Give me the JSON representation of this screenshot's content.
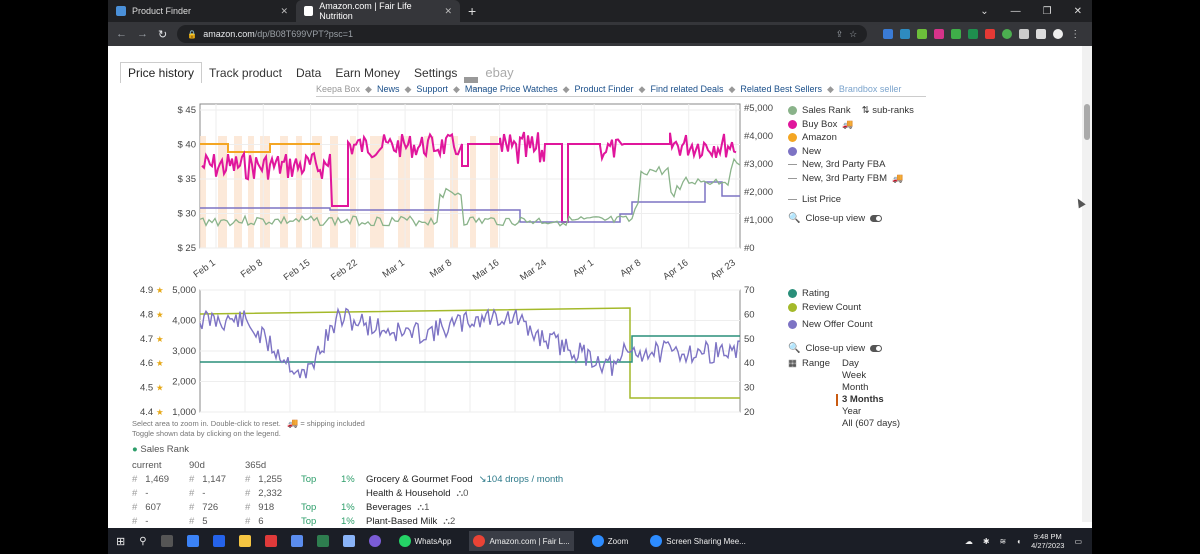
{
  "browser": {
    "tabs": [
      {
        "title": "Product Finder",
        "active": false
      },
      {
        "title": "Amazon.com | Fair Life Nutrition",
        "active": true
      }
    ],
    "new_tab": "+",
    "url_host": "amazon.com",
    "url_path": "/dp/B08T699VPT?psc=1"
  },
  "keepa": {
    "tabs": [
      "Price history",
      "Track product",
      "Data",
      "Earn Money",
      "Settings",
      "—",
      "ebay"
    ],
    "links": [
      "Keepa Box",
      "News",
      "Support",
      "Manage Price Watches",
      "Product Finder",
      "Find related Deals",
      "Related Best Sellers",
      "Brandbox seller"
    ]
  },
  "colors": {
    "sales_rank": "#8ab38a",
    "buy_box": "#e0169c",
    "amazon": "#f4a623",
    "new": "#7d73c4",
    "rating": "#2a8f7a",
    "review_count": "#a4b92a",
    "new_offer": "#7d73c4"
  },
  "price_chart": {
    "legend": [
      {
        "label": "Sales Rank",
        "extra": "sub-ranks",
        "icon": "dot",
        "color_key": "sales_rank"
      },
      {
        "label": "Buy Box",
        "icon": "dot",
        "color_key": "buy_box",
        "truck": true
      },
      {
        "label": "Amazon",
        "icon": "dot",
        "color_key": "amazon"
      },
      {
        "label": "New",
        "icon": "dot",
        "color_key": "new"
      },
      {
        "label": "New, 3rd Party FBA",
        "icon": "dash"
      },
      {
        "label": "New, 3rd Party FBM",
        "icon": "dash",
        "truck": true
      },
      {
        "label": "List Price",
        "icon": "dash"
      }
    ],
    "closeup": "Close-up view",
    "y_left_ticks": [
      "$ 45",
      "$ 40",
      "$ 35",
      "$ 30",
      "$ 25"
    ],
    "y_right_ticks": [
      "#5,000",
      "#4,000",
      "#3,000",
      "#2,000",
      "#1,000",
      "#0"
    ],
    "x_ticks": [
      "Feb 1",
      "Feb 8",
      "Feb 15",
      "Feb 22",
      "Mar 1",
      "Mar 8",
      "Mar 16",
      "Mar 24",
      "Apr 1",
      "Apr 8",
      "Apr 16",
      "Apr 23"
    ]
  },
  "rating_chart": {
    "legend": [
      {
        "label": "Rating",
        "color_key": "rating"
      },
      {
        "label": "Review Count",
        "color_key": "review_count"
      },
      {
        "label": "New Offer Count",
        "color_key": "new_offer"
      }
    ],
    "closeup": "Close-up view",
    "range_label": "Range",
    "ranges": [
      "Day",
      "Week",
      "Month",
      "3 Months",
      "Year",
      "All (607 days)"
    ],
    "selected_range": "3 Months",
    "y_rating_ticks": [
      "4.9",
      "4.8",
      "4.7",
      "4.6",
      "4.5",
      "4.4"
    ],
    "y_count_ticks": [
      "5,000",
      "4,000",
      "3,000",
      "2,000",
      "1,000"
    ],
    "y_right_ticks": [
      "70",
      "60",
      "50",
      "40",
      "30",
      "20"
    ]
  },
  "notes": {
    "line1": "Select area to zoom in. Double-click to reset.",
    "shipping": "= shipping included",
    "line2": "Toggle shown data by clicking on the legend."
  },
  "sales_rank_table": {
    "title": "Sales Rank",
    "headers": [
      "current",
      "90d",
      "365d"
    ],
    "rows": [
      {
        "current": "1,469",
        "d90": "1,147",
        "d365": "1,255",
        "top": "Top",
        "pct": "1%",
        "category": "Grocery & Gourmet Food",
        "extra": "104 drops / month"
      },
      {
        "current": "-",
        "d90": "-",
        "d365": "2,332",
        "top": "",
        "pct": "",
        "category": "Health & Household",
        "extra": "0"
      },
      {
        "current": "607",
        "d90": "726",
        "d365": "918",
        "top": "Top",
        "pct": "1%",
        "category": "Beverages",
        "extra": "1"
      },
      {
        "current": "-",
        "d90": "5",
        "d365": "6",
        "top": "Top",
        "pct": "1%",
        "category": "Plant-Based Milk",
        "extra": "2"
      }
    ]
  },
  "taskbar": {
    "apps": [
      "WhatsApp",
      "Amazon.com | Fair L...",
      "Zoom",
      "Screen Sharing Mee..."
    ],
    "time": "9:48 PM",
    "date": "4/27/2023"
  }
}
